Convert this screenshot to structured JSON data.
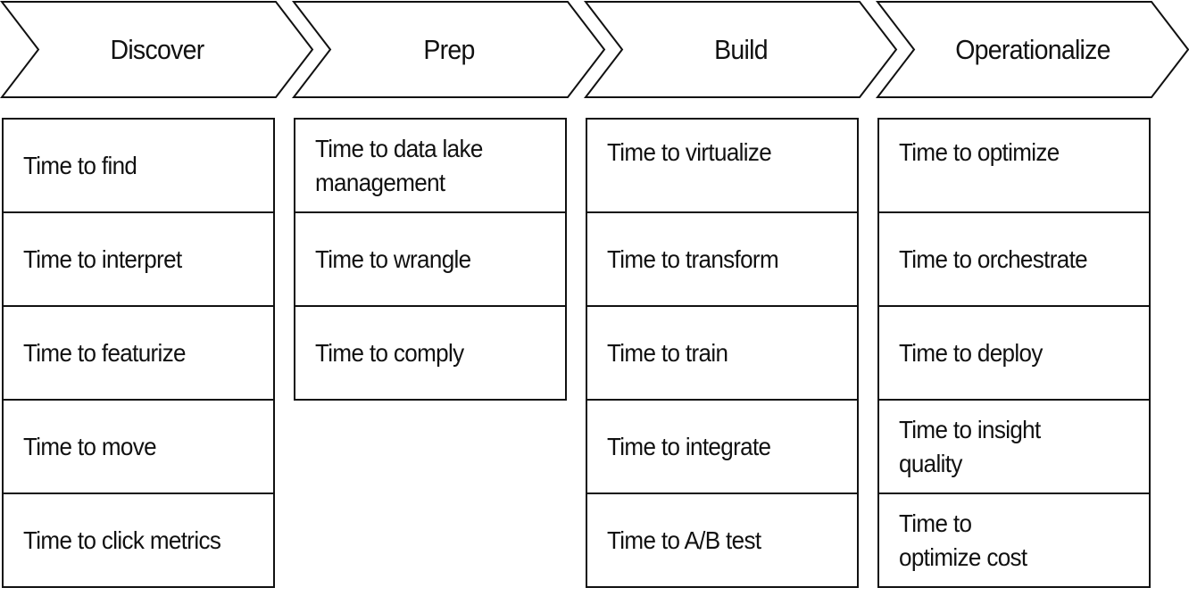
{
  "stages": [
    {
      "label": "Discover",
      "items": [
        "Time to find",
        "Time to interpret",
        "Time to featurize",
        "Time to move",
        "Time to click metrics"
      ]
    },
    {
      "label": "Prep",
      "items": [
        "Time to data lake management",
        "Time to wrangle",
        "Time to comply"
      ]
    },
    {
      "label": "Build",
      "items": [
        "Time to virtualize",
        "Time to transform",
        "Time to train",
        "Time to integrate",
        "Time to A/B test"
      ]
    },
    {
      "label": "Operationalize",
      "items": [
        "Time to optimize",
        "Time to orchestrate",
        "Time to deploy",
        "Time to insight quality",
        "Time to optimize cost"
      ]
    }
  ]
}
